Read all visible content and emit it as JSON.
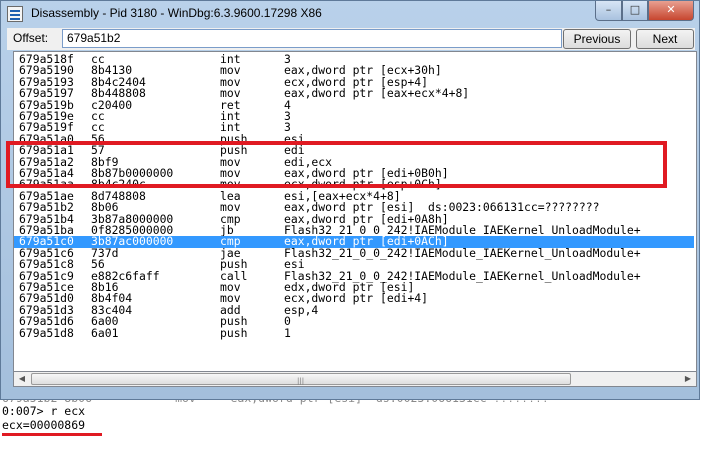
{
  "window": {
    "title": "Disassembly - Pid 3180 - WinDbg:6.3.9600.17298 X86",
    "minimize_glyph": "–",
    "maximize_glyph": "□",
    "close_glyph": "✕"
  },
  "offset_bar": {
    "label": "Offset:",
    "value": "679a51b2",
    "previous_label": "Previous",
    "next_label": "Next"
  },
  "disassembly": {
    "selected_index": 16,
    "rows": [
      {
        "addr": "679a518f",
        "bytes": "cc",
        "mnem": "int",
        "ops": "3"
      },
      {
        "addr": "679a5190",
        "bytes": "8b4130",
        "mnem": "mov",
        "ops": "eax,dword ptr [ecx+30h]"
      },
      {
        "addr": "679a5193",
        "bytes": "8b4c2404",
        "mnem": "mov",
        "ops": "ecx,dword ptr [esp+4]"
      },
      {
        "addr": "679a5197",
        "bytes": "8b448808",
        "mnem": "mov",
        "ops": "eax,dword ptr [eax+ecx*4+8]"
      },
      {
        "addr": "679a519b",
        "bytes": "c20400",
        "mnem": "ret",
        "ops": "4"
      },
      {
        "addr": "679a519e",
        "bytes": "cc",
        "mnem": "int",
        "ops": "3"
      },
      {
        "addr": "679a519f",
        "bytes": "cc",
        "mnem": "int",
        "ops": "3"
      },
      {
        "addr": "679a51a0",
        "bytes": "56",
        "mnem": "push",
        "ops": "esi"
      },
      {
        "addr": "679a51a1",
        "bytes": "57",
        "mnem": "push",
        "ops": "edi"
      },
      {
        "addr": "679a51a2",
        "bytes": "8bf9",
        "mnem": "mov",
        "ops": "edi,ecx"
      },
      {
        "addr": "679a51a4",
        "bytes": "8b87b0000000",
        "mnem": "mov",
        "ops": "eax,dword ptr [edi+0B0h]"
      },
      {
        "addr": "679a51aa",
        "bytes": "8b4c240c",
        "mnem": "mov",
        "ops": "ecx,dword ptr [esp+0Ch]"
      },
      {
        "addr": "679a51ae",
        "bytes": "8d748808",
        "mnem": "lea",
        "ops": "esi,[eax+ecx*4+8]"
      },
      {
        "addr": "679a51b2",
        "bytes": "8b06",
        "mnem": "mov",
        "ops": "eax,dword ptr [esi]  ds:0023:066131cc=????????"
      },
      {
        "addr": "679a51b4",
        "bytes": "3b87a8000000",
        "mnem": "cmp",
        "ops": "eax,dword ptr [edi+0A8h]"
      },
      {
        "addr": "679a51ba",
        "bytes": "0f8285000000",
        "mnem": "jb",
        "ops": "Flash32_21_0_0_242!IAEModule_IAEKernel_UnloadModule+"
      },
      {
        "addr": "679a51c0",
        "bytes": "3b87ac000000",
        "mnem": "cmp",
        "ops": "eax,dword ptr [edi+0ACh]"
      },
      {
        "addr": "679a51c6",
        "bytes": "737d",
        "mnem": "jae",
        "ops": "Flash32_21_0_0_242!IAEModule_IAEKernel_UnloadModule+"
      },
      {
        "addr": "679a51c8",
        "bytes": "56",
        "mnem": "push",
        "ops": "esi"
      },
      {
        "addr": "679a51c9",
        "bytes": "e882c6faff",
        "mnem": "call",
        "ops": "Flash32_21_0_0_242!IAEModule_IAEKernel_UnloadModule+"
      },
      {
        "addr": "679a51ce",
        "bytes": "8b16",
        "mnem": "mov",
        "ops": "edx,dword ptr [esi]"
      },
      {
        "addr": "679a51d0",
        "bytes": "8b4f04",
        "mnem": "mov",
        "ops": "ecx,dword ptr [edi+4]"
      },
      {
        "addr": "679a51d3",
        "bytes": "83c404",
        "mnem": "add",
        "ops": "esp,4"
      },
      {
        "addr": "679a51d6",
        "bytes": "6a00",
        "mnem": "push",
        "ops": "0"
      },
      {
        "addr": "679a51d8",
        "bytes": "6a01",
        "mnem": "push",
        "ops": "1"
      }
    ]
  },
  "console": {
    "faded_line": "679a51b2 8b06            mov     eax,dword ptr [esi]  ds:0023:066131cc=????????",
    "command_line": "0:007> r ecx",
    "result_line": "ecx=00000869"
  }
}
